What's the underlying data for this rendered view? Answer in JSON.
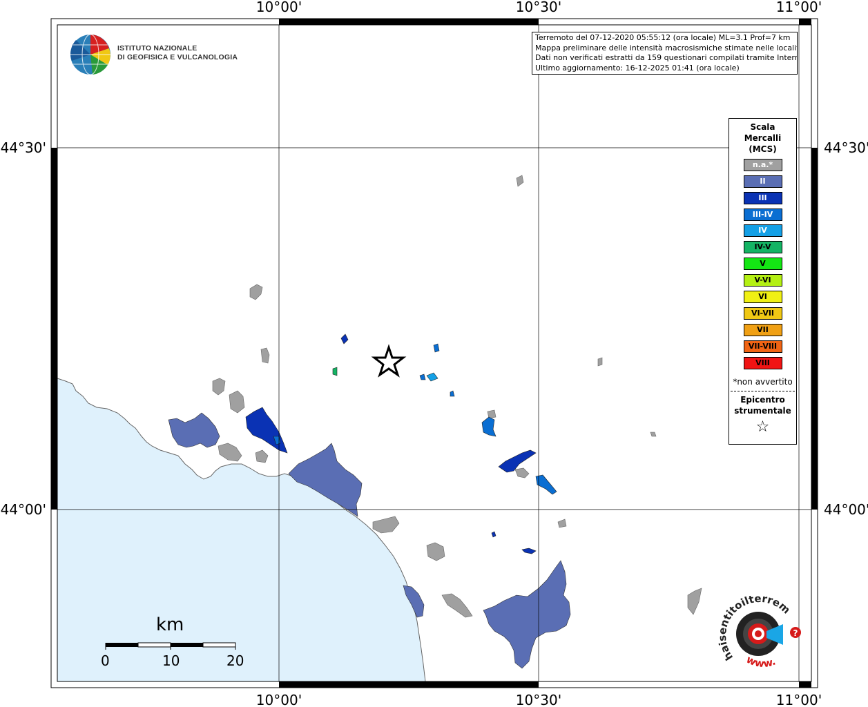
{
  "logo": {
    "line1": "ISTITUTO NAZIONALE",
    "line2": "DI GEOFISICA E VULCANOLOGIA"
  },
  "info": {
    "line1": "Terremoto del 07-12-2020 05:55:12 (ora locale) ML=3.1 Prof=7 km",
    "line2": "Mappa preliminare delle intensità macrosismiche stimate nelle località",
    "line3": "Dati non verificati estratti da 159 questionari compilati tramite Internet.",
    "line4": "Ultimo aggiornamento: 16-12-2025 01:41 (ora locale)"
  },
  "axes": {
    "lon_labels": [
      "10°00'",
      "10°30'",
      "11°00'"
    ],
    "lat_labels": [
      "44°30'",
      "44°00'"
    ]
  },
  "legend": {
    "title1": "Scala",
    "title2": "Mercalli",
    "title3": "(MCS)",
    "classes": [
      {
        "label": "n.a.*",
        "color": "#a0a0a0",
        "text_color": "#ffffff"
      },
      {
        "label": "II",
        "color": "#5a6eb4",
        "text_color": "#ffffff"
      },
      {
        "label": "III",
        "color": "#0a32b4",
        "text_color": "#ffffff"
      },
      {
        "label": "III-IV",
        "color": "#0a6ed2",
        "text_color": "#ffffff"
      },
      {
        "label": "IV",
        "color": "#14a0e6",
        "text_color": "#ffffff"
      },
      {
        "label": "IV-V",
        "color": "#14b464",
        "text_color": "#000000"
      },
      {
        "label": "V",
        "color": "#14e614",
        "text_color": "#000000"
      },
      {
        "label": "V-VI",
        "color": "#b4f014",
        "text_color": "#000000"
      },
      {
        "label": "VI",
        "color": "#f0f014",
        "text_color": "#000000"
      },
      {
        "label": "VI-VII",
        "color": "#f0c814",
        "text_color": "#000000"
      },
      {
        "label": "VII",
        "color": "#f0a014",
        "text_color": "#000000"
      },
      {
        "label": "VII-VIII",
        "color": "#f06414",
        "text_color": "#000000"
      },
      {
        "label": "VIII",
        "color": "#f01414",
        "text_color": "#000000"
      }
    ],
    "note": "*non avvertito",
    "epi1": "Epicentro",
    "epi2": "strumentale",
    "epi_symbol": "star-outline"
  },
  "scale_bar": {
    "unit": "km",
    "ticks": [
      "0",
      "10",
      "20"
    ]
  },
  "watermark": {
    "text": "haisentitoilterremoto.it",
    "url_text": "www."
  },
  "colors": {
    "sea": "#dff1fc",
    "na": "#a0a0a0",
    "II": "#5a6eb4",
    "III": "#0a32b4",
    "IIIIV": "#0a6ed2",
    "IV": "#14a0e6",
    "IVV": "#14b464"
  }
}
